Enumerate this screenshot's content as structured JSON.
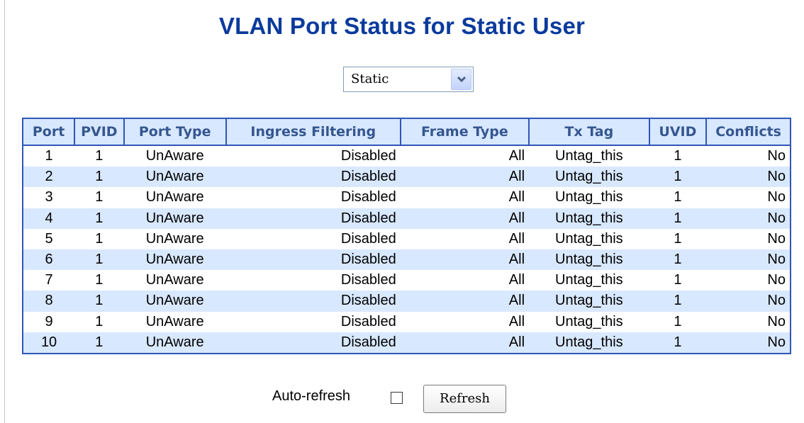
{
  "page": {
    "title": "VLAN Port Status for Static User",
    "user_select": {
      "value": "Static"
    }
  },
  "table": {
    "headers": [
      "Port",
      "PVID",
      "Port Type",
      "Ingress Filtering",
      "Frame Type",
      "Tx Tag",
      "UVID",
      "Conflicts"
    ],
    "rows": [
      {
        "port": "1",
        "pvid": "1",
        "port_type": "UnAware",
        "ingress": "Disabled",
        "frame": "All",
        "tx_tag": "Untag_this",
        "uvid": "1",
        "conflicts": "No"
      },
      {
        "port": "2",
        "pvid": "1",
        "port_type": "UnAware",
        "ingress": "Disabled",
        "frame": "All",
        "tx_tag": "Untag_this",
        "uvid": "1",
        "conflicts": "No"
      },
      {
        "port": "3",
        "pvid": "1",
        "port_type": "UnAware",
        "ingress": "Disabled",
        "frame": "All",
        "tx_tag": "Untag_this",
        "uvid": "1",
        "conflicts": "No"
      },
      {
        "port": "4",
        "pvid": "1",
        "port_type": "UnAware",
        "ingress": "Disabled",
        "frame": "All",
        "tx_tag": "Untag_this",
        "uvid": "1",
        "conflicts": "No"
      },
      {
        "port": "5",
        "pvid": "1",
        "port_type": "UnAware",
        "ingress": "Disabled",
        "frame": "All",
        "tx_tag": "Untag_this",
        "uvid": "1",
        "conflicts": "No"
      },
      {
        "port": "6",
        "pvid": "1",
        "port_type": "UnAware",
        "ingress": "Disabled",
        "frame": "All",
        "tx_tag": "Untag_this",
        "uvid": "1",
        "conflicts": "No"
      },
      {
        "port": "7",
        "pvid": "1",
        "port_type": "UnAware",
        "ingress": "Disabled",
        "frame": "All",
        "tx_tag": "Untag_this",
        "uvid": "1",
        "conflicts": "No"
      },
      {
        "port": "8",
        "pvid": "1",
        "port_type": "UnAware",
        "ingress": "Disabled",
        "frame": "All",
        "tx_tag": "Untag_this",
        "uvid": "1",
        "conflicts": "No"
      },
      {
        "port": "9",
        "pvid": "1",
        "port_type": "UnAware",
        "ingress": "Disabled",
        "frame": "All",
        "tx_tag": "Untag_this",
        "uvid": "1",
        "conflicts": "No"
      },
      {
        "port": "10",
        "pvid": "1",
        "port_type": "UnAware",
        "ingress": "Disabled",
        "frame": "All",
        "tx_tag": "Untag_this",
        "uvid": "1",
        "conflicts": "No"
      }
    ]
  },
  "footer": {
    "auto_refresh_label": "Auto-refresh",
    "auto_refresh_checked": false,
    "refresh_label": "Refresh"
  },
  "colors": {
    "title": "#0a3a9c",
    "header_bg": "#d8e8ff",
    "header_text": "#35568f",
    "table_border": "#2f56b7",
    "alt_row_bg": "#d8e8ff"
  },
  "icons": {
    "select_arrow": "chevron-down-icon"
  }
}
